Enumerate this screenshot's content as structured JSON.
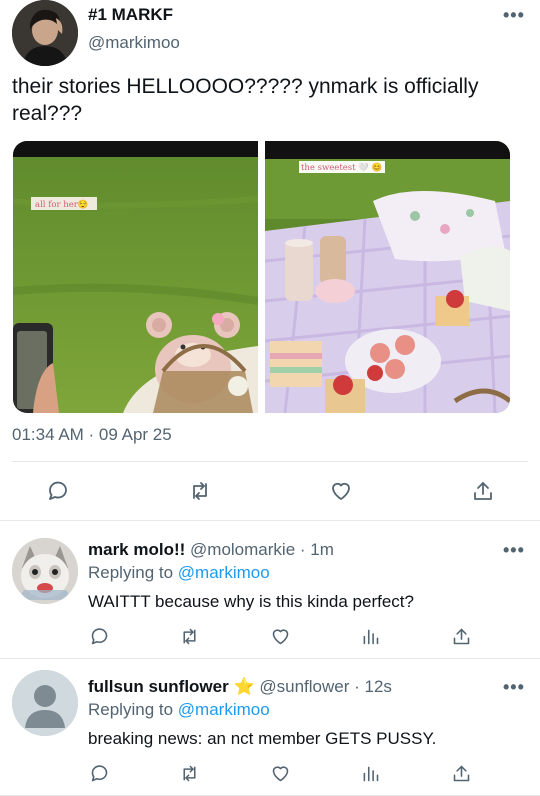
{
  "main_tweet": {
    "display_name": "#1 MARKF",
    "handle": "@markimoo",
    "text": "their stories HELLOOOO????? ynmark is officially real???",
    "image_left_caption": "all for her😌",
    "image_right_caption": "the sweetest 🤍 😊",
    "timestamp": "01:34 AM · 09 Apr 25"
  },
  "replies": [
    {
      "display_name": "mark molo!!",
      "handle": "@molomarkie",
      "time": "· 1m",
      "replying_prefix": "Replying to",
      "replying_handle": "@markimoo",
      "text": "WAITTT because why is this kinda perfect?"
    },
    {
      "display_name": "fullsun sunflower",
      "badge": "⭐",
      "handle": "@sunflower",
      "time": "· 12s",
      "replying_prefix": "Replying to",
      "replying_handle": "@markimoo",
      "text": "breaking news: an nct member GETS PUSSY."
    }
  ],
  "icons": [
    "reply-icon",
    "retweet-icon",
    "like-icon",
    "analytics-icon",
    "share-icon",
    "more-icon"
  ],
  "colors": {
    "accent": "#1d9bf0",
    "muted": "#536471",
    "text": "#0f1419",
    "divider": "#e6e9ec"
  }
}
